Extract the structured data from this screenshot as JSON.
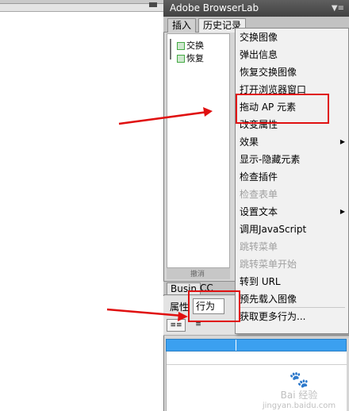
{
  "panel": {
    "title": "Adobe BrowserLab",
    "menu_glyph": "▼≡"
  },
  "tabs": {
    "insert": "插入",
    "history": "历史记录"
  },
  "history": {
    "item1": "交换",
    "item2": "恢复",
    "bottom": "撤消"
  },
  "business": {
    "tab": "Busin",
    "tab2": "CC"
  },
  "properties": {
    "label": "属性",
    "select_value": "行为",
    "list_button": "≡≡",
    "sort_button": "≡"
  },
  "menu": {
    "items": [
      {
        "label": "交换图像",
        "enabled": true,
        "submenu": false
      },
      {
        "label": "弹出信息",
        "enabled": true,
        "submenu": false
      },
      {
        "label": "恢复交换图像",
        "enabled": true,
        "submenu": false
      },
      {
        "label": "打开浏览器窗口",
        "enabled": true,
        "submenu": false
      },
      {
        "label": "拖动 AP 元素",
        "enabled": true,
        "submenu": false
      },
      {
        "label": "改变属性",
        "enabled": true,
        "submenu": false
      },
      {
        "label": "效果",
        "enabled": true,
        "submenu": true
      },
      {
        "label": "显示-隐藏元素",
        "enabled": true,
        "submenu": false
      },
      {
        "label": "检查插件",
        "enabled": true,
        "submenu": false
      },
      {
        "label": "检查表单",
        "enabled": false,
        "submenu": false
      },
      {
        "label": "设置文本",
        "enabled": true,
        "submenu": true
      },
      {
        "label": "调用JavaScript",
        "enabled": true,
        "submenu": false
      },
      {
        "label": "跳转菜单",
        "enabled": false,
        "submenu": false
      },
      {
        "label": "跳转菜单开始",
        "enabled": false,
        "submenu": false
      },
      {
        "label": "转到 URL",
        "enabled": true,
        "submenu": false
      },
      {
        "label": "预先载入图像",
        "enabled": true,
        "submenu": false
      },
      {
        "label": "获取更多行为...",
        "enabled": true,
        "submenu": false
      }
    ],
    "submenu_glyph": "▶"
  },
  "watermark": {
    "paw": "🐾",
    "brand": "Bai 经验",
    "url": "jingyan.baidu.com"
  },
  "colors": {
    "annotation_red": "#e01010",
    "selection_blue": "#3ba0f0"
  }
}
